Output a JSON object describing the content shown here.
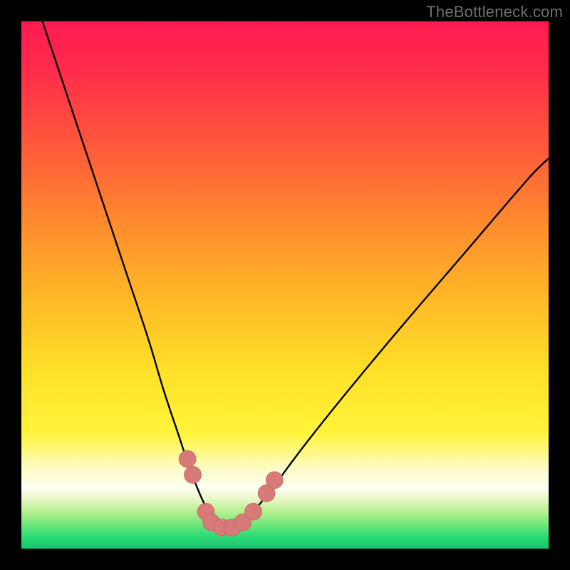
{
  "watermark": "TheBottleneck.com",
  "colors": {
    "page_bg": "#000000",
    "curve_stroke": "#000000",
    "marker_fill": "#d77a78",
    "marker_stroke": "#c96a68",
    "gradient_stops": [
      {
        "offset": 0.0,
        "color": "#ff1a52"
      },
      {
        "offset": 0.1,
        "color": "#ff2e4a"
      },
      {
        "offset": 0.24,
        "color": "#ff5a3a"
      },
      {
        "offset": 0.38,
        "color": "#ff8a2e"
      },
      {
        "offset": 0.52,
        "color": "#ffb627"
      },
      {
        "offset": 0.66,
        "color": "#ffe028"
      },
      {
        "offset": 0.78,
        "color": "#fff43a"
      },
      {
        "offset": 0.85,
        "color": "#fdfcc8"
      },
      {
        "offset": 0.885,
        "color": "#fefef2"
      },
      {
        "offset": 0.905,
        "color": "#e9f7c8"
      },
      {
        "offset": 0.93,
        "color": "#b6f090"
      },
      {
        "offset": 0.955,
        "color": "#6fe779"
      },
      {
        "offset": 0.975,
        "color": "#2fdd76"
      },
      {
        "offset": 1.0,
        "color": "#14c66b"
      }
    ]
  },
  "chart_data": {
    "type": "line",
    "title": "",
    "xlabel": "",
    "ylabel": "",
    "xlim": [
      0,
      100
    ],
    "ylim": [
      0,
      100
    ],
    "grid": false,
    "legend": false,
    "series": [
      {
        "name": "bottleneck-curve",
        "x": [
          4,
          8,
          12,
          16,
          20,
          24,
          27,
          30,
          32,
          34,
          35.5,
          37,
          38.5,
          40,
          42,
          44,
          48,
          54,
          62,
          72,
          84,
          96,
          100
        ],
        "y": [
          100,
          88,
          76,
          64,
          52,
          40,
          30,
          21,
          15,
          10,
          7,
          5,
          4,
          4,
          5,
          7,
          12,
          20,
          30,
          42,
          56,
          70,
          74
        ]
      }
    ],
    "markers": {
      "name": "highlight-points",
      "points": [
        {
          "x": 31.5,
          "y": 17
        },
        {
          "x": 32.5,
          "y": 14
        },
        {
          "x": 35.0,
          "y": 7
        },
        {
          "x": 36.0,
          "y": 5
        },
        {
          "x": 38.0,
          "y": 4
        },
        {
          "x": 40.0,
          "y": 4
        },
        {
          "x": 42.0,
          "y": 5
        },
        {
          "x": 44.0,
          "y": 7
        },
        {
          "x": 46.5,
          "y": 10.5
        },
        {
          "x": 48.0,
          "y": 13
        }
      ],
      "radius_data_units": 1.6
    }
  }
}
